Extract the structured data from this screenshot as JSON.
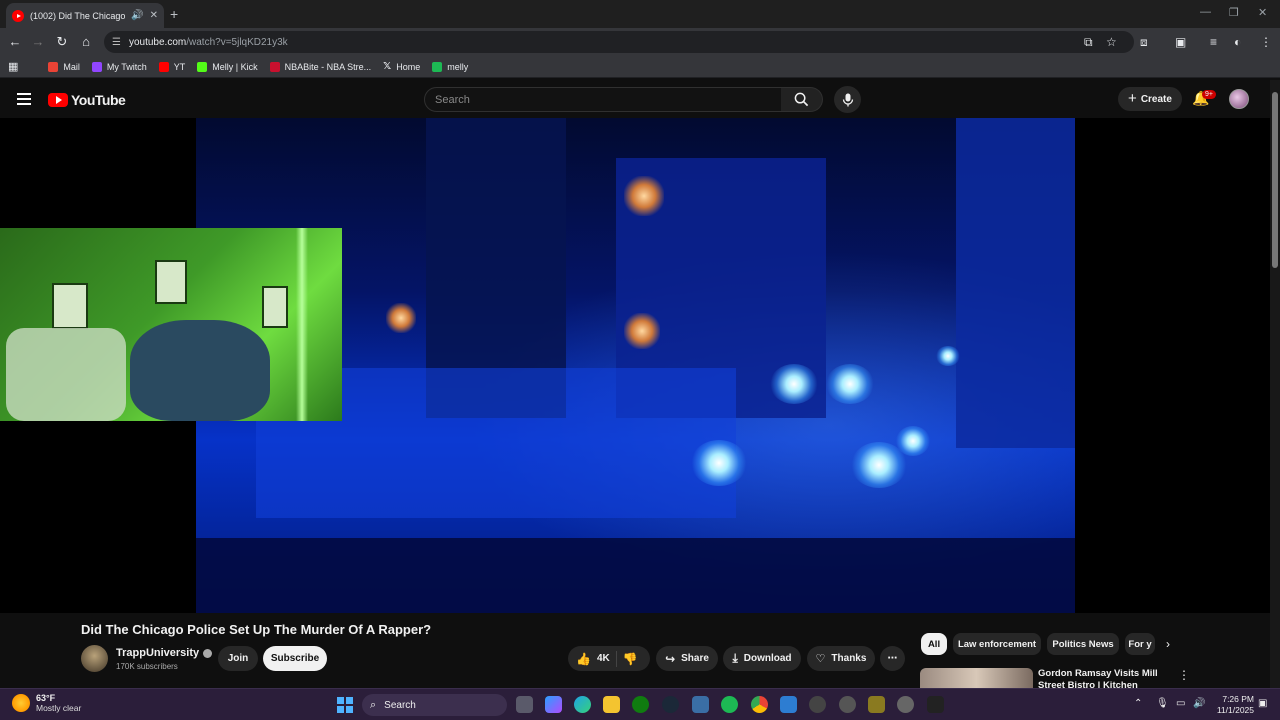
{
  "browser": {
    "tab_title": "(1002) Did The Chicago Poli",
    "url_host": "youtube.com",
    "url_path": "/watch?v=5jlqKD21y3k",
    "bookmarks": [
      {
        "label": "Mail",
        "color": "#ea4335"
      },
      {
        "label": "My Twitch",
        "color": "#9146ff"
      },
      {
        "label": "YT",
        "color": "#ff0000"
      },
      {
        "label": "Melly | Kick",
        "color": "#53fc18"
      },
      {
        "label": "NBABite - NBA Stre...",
        "color": "#c8102e"
      },
      {
        "label": "Home",
        "color": "#ffffff"
      },
      {
        "label": "melly",
        "color": "#1db954"
      }
    ]
  },
  "youtube": {
    "logo_text": "YouTube",
    "search_placeholder": "Search",
    "create_label": "Create",
    "notif_badge": "9+"
  },
  "video": {
    "title": "Did The Chicago Police Set Up The Murder Of A Rapper?",
    "channel": "TrappUniversity",
    "subscribers": "170K subscribers",
    "join_label": "Join",
    "subscribe_label": "Subscribe",
    "likes": "4K",
    "share_label": "Share",
    "download_label": "Download",
    "thanks_label": "Thanks"
  },
  "chips": [
    "All",
    "Law enforcement",
    "Politics News",
    "For y"
  ],
  "recommendation": {
    "title": "Gordon Ramsay Visits Mill Street Bistro | Kitchen"
  },
  "taskbar": {
    "temperature": "63°F",
    "weather": "Mostly clear",
    "search_label": "Search",
    "time": "7:26 PM",
    "date": "11/1/2025"
  }
}
